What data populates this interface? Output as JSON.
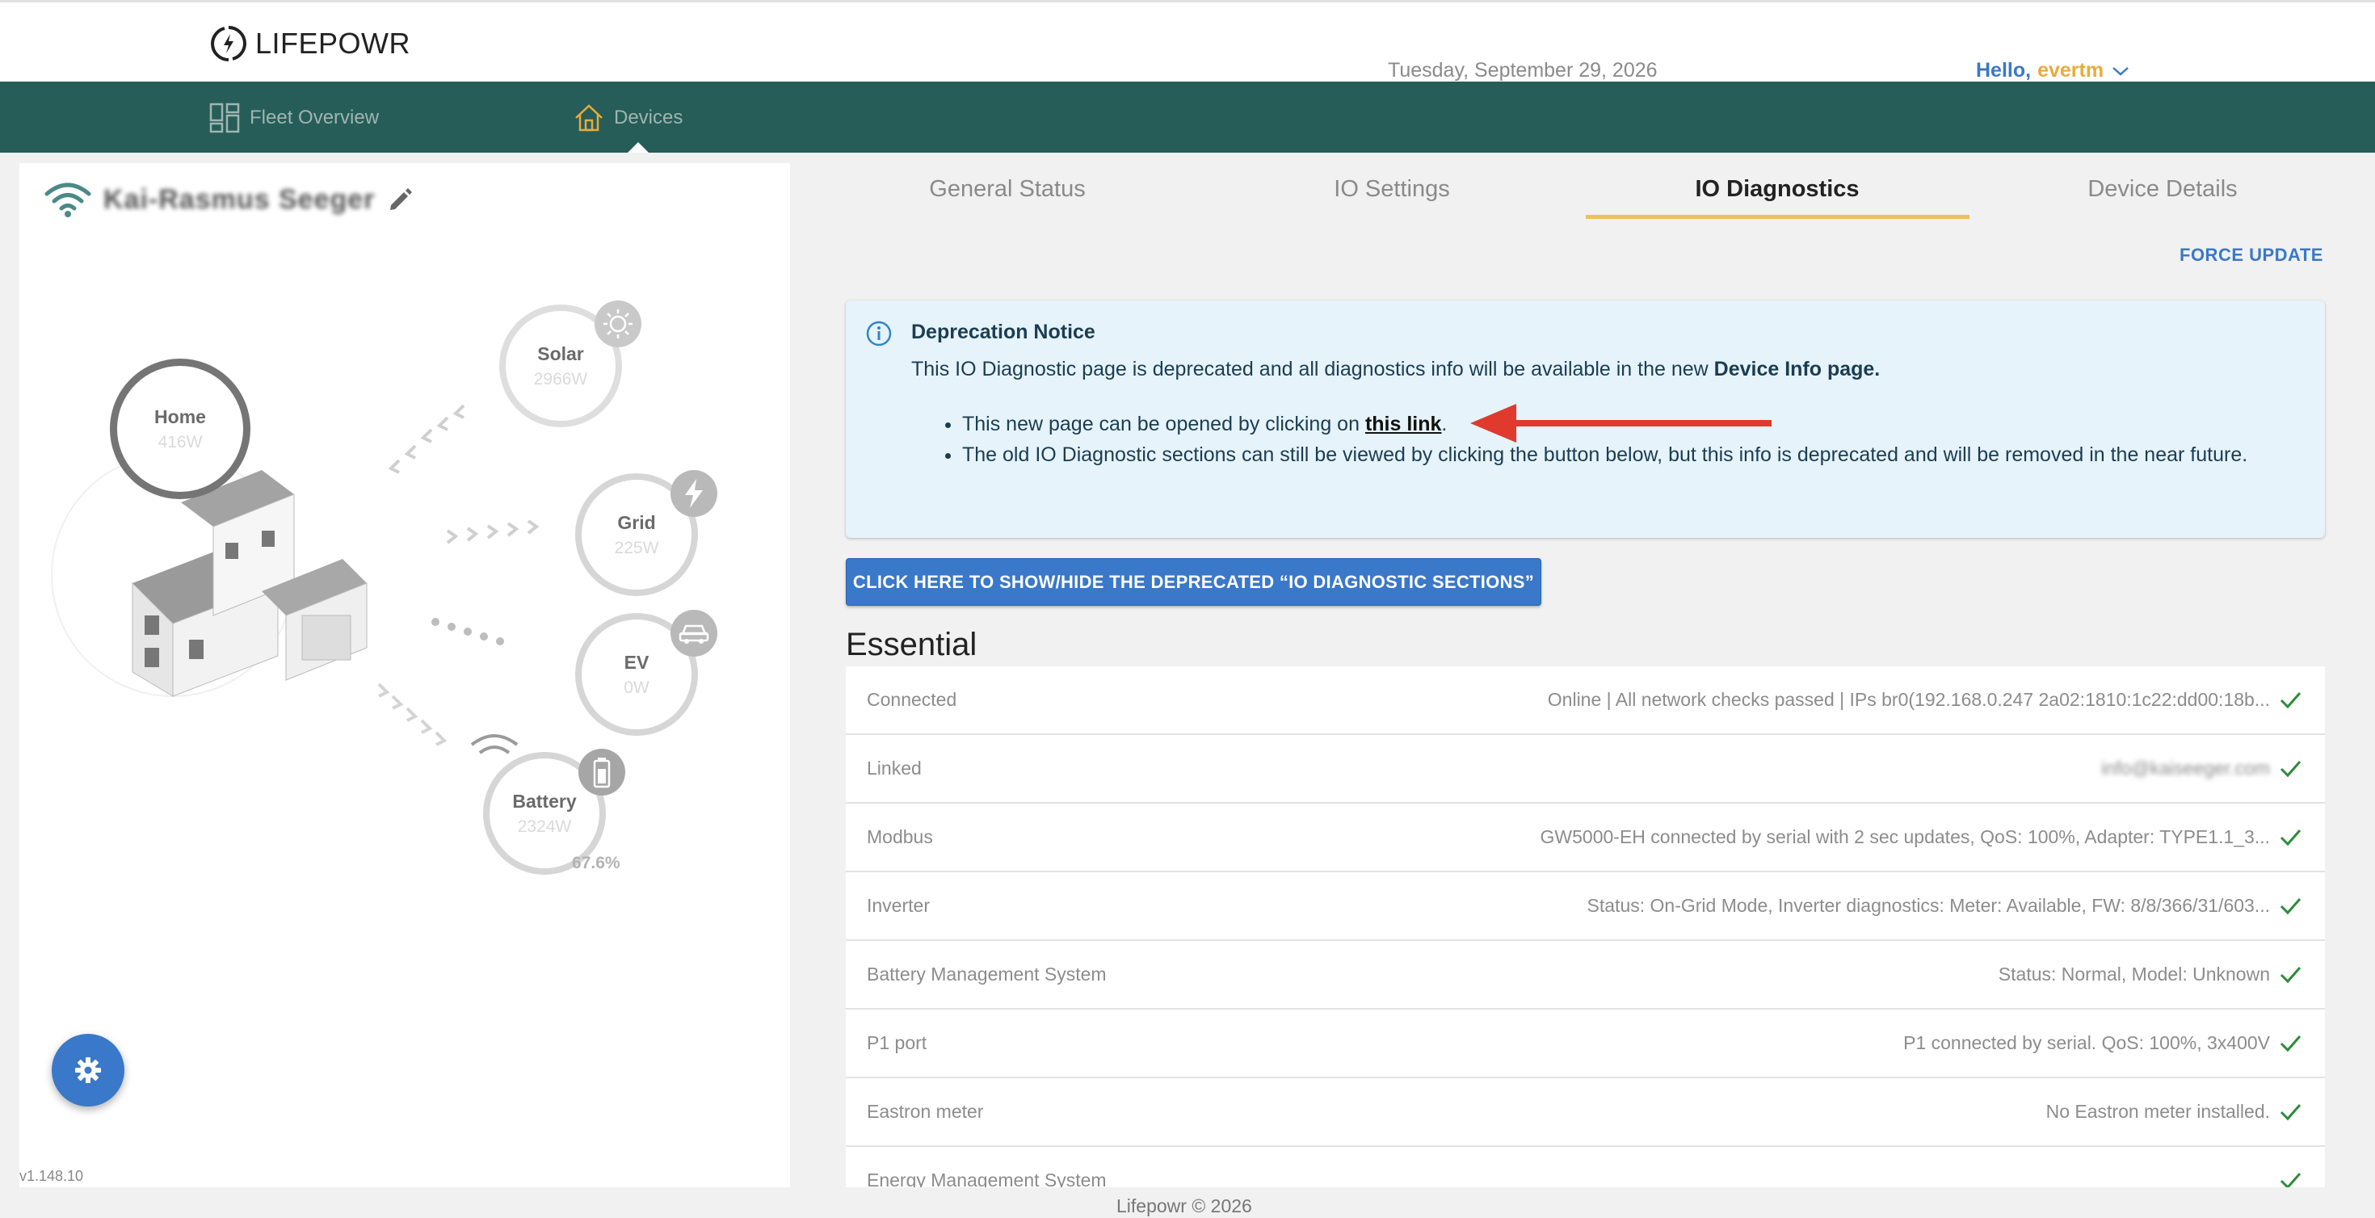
{
  "header": {
    "logo_text": "LIFEPOWR",
    "date": "Tuesday, September 29, 2026",
    "greeting": "Hello,",
    "username": "evertm"
  },
  "nav": {
    "items": [
      {
        "label": "Fleet Overview",
        "icon": "grid-icon"
      },
      {
        "label": "Devices",
        "icon": "home-icon"
      }
    ],
    "active": "Devices"
  },
  "device": {
    "name": "Kai-Rasmus Seeger",
    "home": {
      "label": "Home",
      "value": "416W"
    },
    "solar": {
      "label": "Solar",
      "value": "2966W"
    },
    "grid": {
      "label": "Grid",
      "value": "225W"
    },
    "ev": {
      "label": "EV",
      "value": "0W"
    },
    "battery": {
      "label": "Battery",
      "value": "2324W",
      "soc": "67.6%"
    },
    "version": "v1.148.10"
  },
  "tabs": [
    {
      "label": "General Status"
    },
    {
      "label": "IO Settings"
    },
    {
      "label": "IO Diagnostics"
    },
    {
      "label": "Device Details"
    }
  ],
  "active_tab": "IO Diagnostics",
  "force_update_label": "FORCE UPDATE",
  "notice": {
    "title": "Deprecation Notice",
    "body_prefix": "This IO Diagnostic page is deprecated and all diagnostics info will be available in the new ",
    "body_bold": "Device Info page.",
    "bullet1_prefix": "This new page can be opened by clicking on ",
    "bullet1_link": "this link",
    "bullet1_suffix": ".",
    "bullet2": "The old IO Diagnostic sections can still be viewed by clicking the button below, but this info is deprecated and will be removed in the near future."
  },
  "toggle_button_label": "CLICK HERE TO SHOW/HIDE THE DEPRECATED “IO DIAGNOSTIC SECTIONS”",
  "essential": {
    "title": "Essential",
    "rows": [
      {
        "name": "Connected",
        "value": "Online | All network checks passed | IPs br0(192.168.0.247 2a02:1810:1c22:dd00:18b..."
      },
      {
        "name": "Linked",
        "value": "info@kaiseeger.com"
      },
      {
        "name": "Modbus",
        "value": "GW5000-EH connected by serial with 2 sec updates, QoS: 100%, Adapter: TYPE1.1_3..."
      },
      {
        "name": "Inverter",
        "value": "Status: On-Grid Mode, Inverter diagnostics: Meter: Available, FW: 8/8/366/31/603..."
      },
      {
        "name": "Battery Management System",
        "value": "Status: Normal, Model: Unknown"
      },
      {
        "name": "P1 port",
        "value": "P1 connected by serial. QoS: 100%, 3x400V"
      },
      {
        "name": "Eastron meter",
        "value": "No Eastron meter installed."
      },
      {
        "name": "Energy Management System",
        "value": ""
      }
    ]
  },
  "footer": "Lifepowr © 2026",
  "colors": {
    "nav_bg": "#265d58",
    "accent_blue": "#3a78c9",
    "tab_underline": "#f0be5b",
    "check_green": "#2e8b3a",
    "notice_bg": "#e6f3fb"
  }
}
